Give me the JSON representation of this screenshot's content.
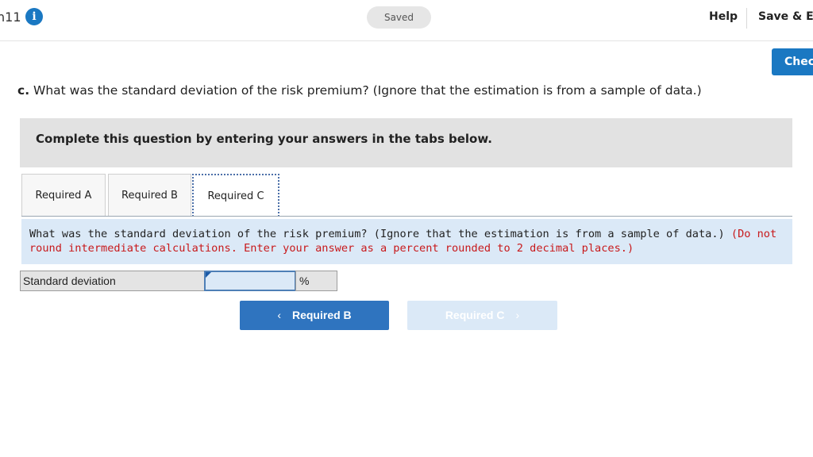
{
  "header": {
    "chapter_label": "h11",
    "info_icon": "info-icon",
    "saved_label": "Saved",
    "help_label": "Help",
    "save_exit_label": "Save & Ex",
    "check_label": "Chec"
  },
  "question": {
    "part": "c.",
    "text": "What was the standard deviation of the risk premium? (Ignore that the estimation is from a sample of data.)"
  },
  "banner": {
    "text": "Complete this question by entering your answers in the tabs below."
  },
  "tabs": [
    {
      "label": "Required A"
    },
    {
      "label": "Required B"
    },
    {
      "label": "Required C",
      "active": true
    }
  ],
  "prompt": {
    "text": "What was the standard deviation of the risk premium? (Ignore that the estimation is from a sample of data.)",
    "note": "(Do not round intermediate calculations. Enter your answer as a percent rounded to 2 decimal places.)"
  },
  "answer": {
    "label": "Standard deviation",
    "value": "",
    "unit": "%"
  },
  "nav": {
    "prev_label": "Required B",
    "prev_chevron": "‹",
    "next_label": "Required C",
    "next_chevron": "›"
  },
  "colors": {
    "accent": "#1a78c2",
    "note_red": "#c8191b",
    "prompt_bg": "#dbe9f7"
  }
}
